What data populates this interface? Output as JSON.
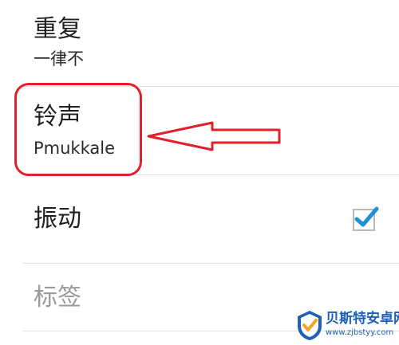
{
  "settings": {
    "repeat": {
      "title": "重复",
      "value": "一律不"
    },
    "ringtone": {
      "title": "铃声",
      "value": "Pmukkale"
    },
    "vibrate": {
      "title": "振动",
      "checked": true
    },
    "label": {
      "placeholder": "标签"
    }
  },
  "annotation": {
    "box_color": "#e0202a",
    "arrow_direction": "left"
  },
  "watermark": {
    "name": "贝斯特安卓网",
    "url": "www.zjbstyy.com",
    "brand_color": "#1e5fb8"
  },
  "colors": {
    "checkbox_check": "#1f8fd6",
    "divider": "#e2e2e2"
  }
}
